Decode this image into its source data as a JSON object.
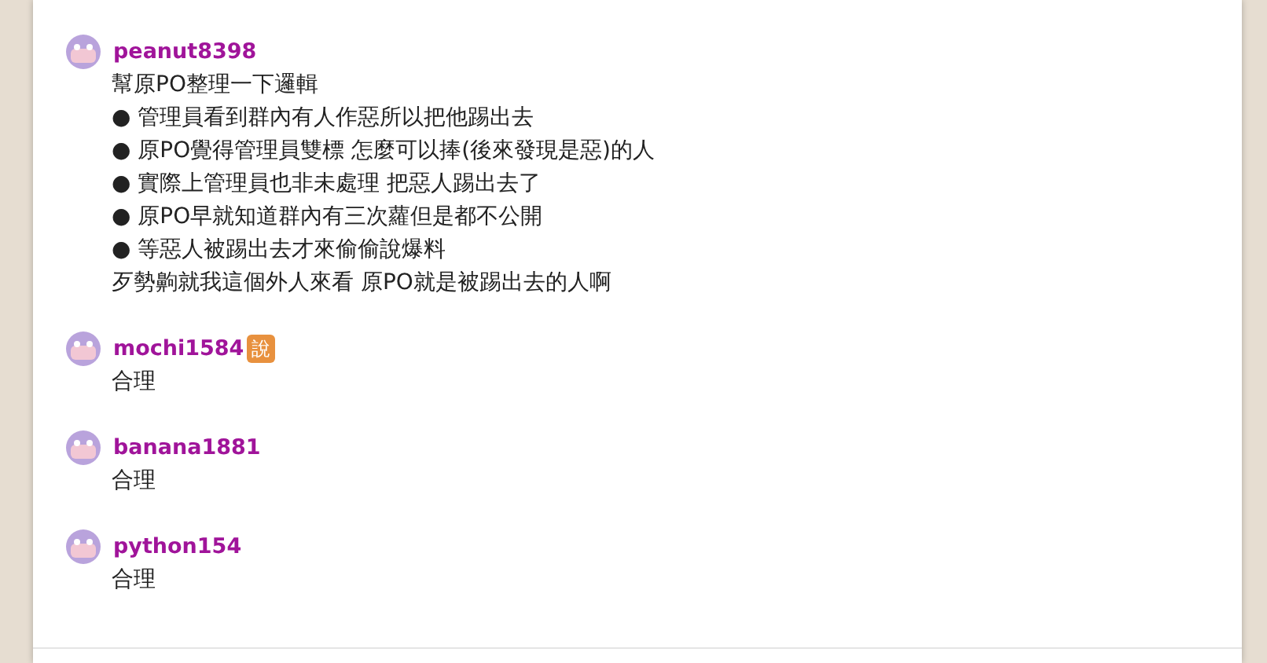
{
  "comments": [
    {
      "username": "peanut8398",
      "lines": [
        "幫原PO整理一下邏輯",
        "● 管理員看到群內有人作惡所以把他踢出去",
        "● 原PO覺得管理員雙標 怎麼可以捧(後來發現是惡)的人",
        "● 實際上管理員也非未處理 把惡人踢出去了",
        "● 原PO早就知道群內有三次蘿但是都不公開",
        "● 等惡人被踢出去才來偷偷說爆料",
        "歹勢齁就我這個外人來看 原PO就是被踢出去的人啊"
      ]
    },
    {
      "username": "mochi1584",
      "badge": "說",
      "lines": [
        "合理"
      ]
    },
    {
      "username": "banana1881",
      "lines": [
        "合理"
      ]
    },
    {
      "username": "python154",
      "lines": [
        "合理"
      ]
    }
  ]
}
